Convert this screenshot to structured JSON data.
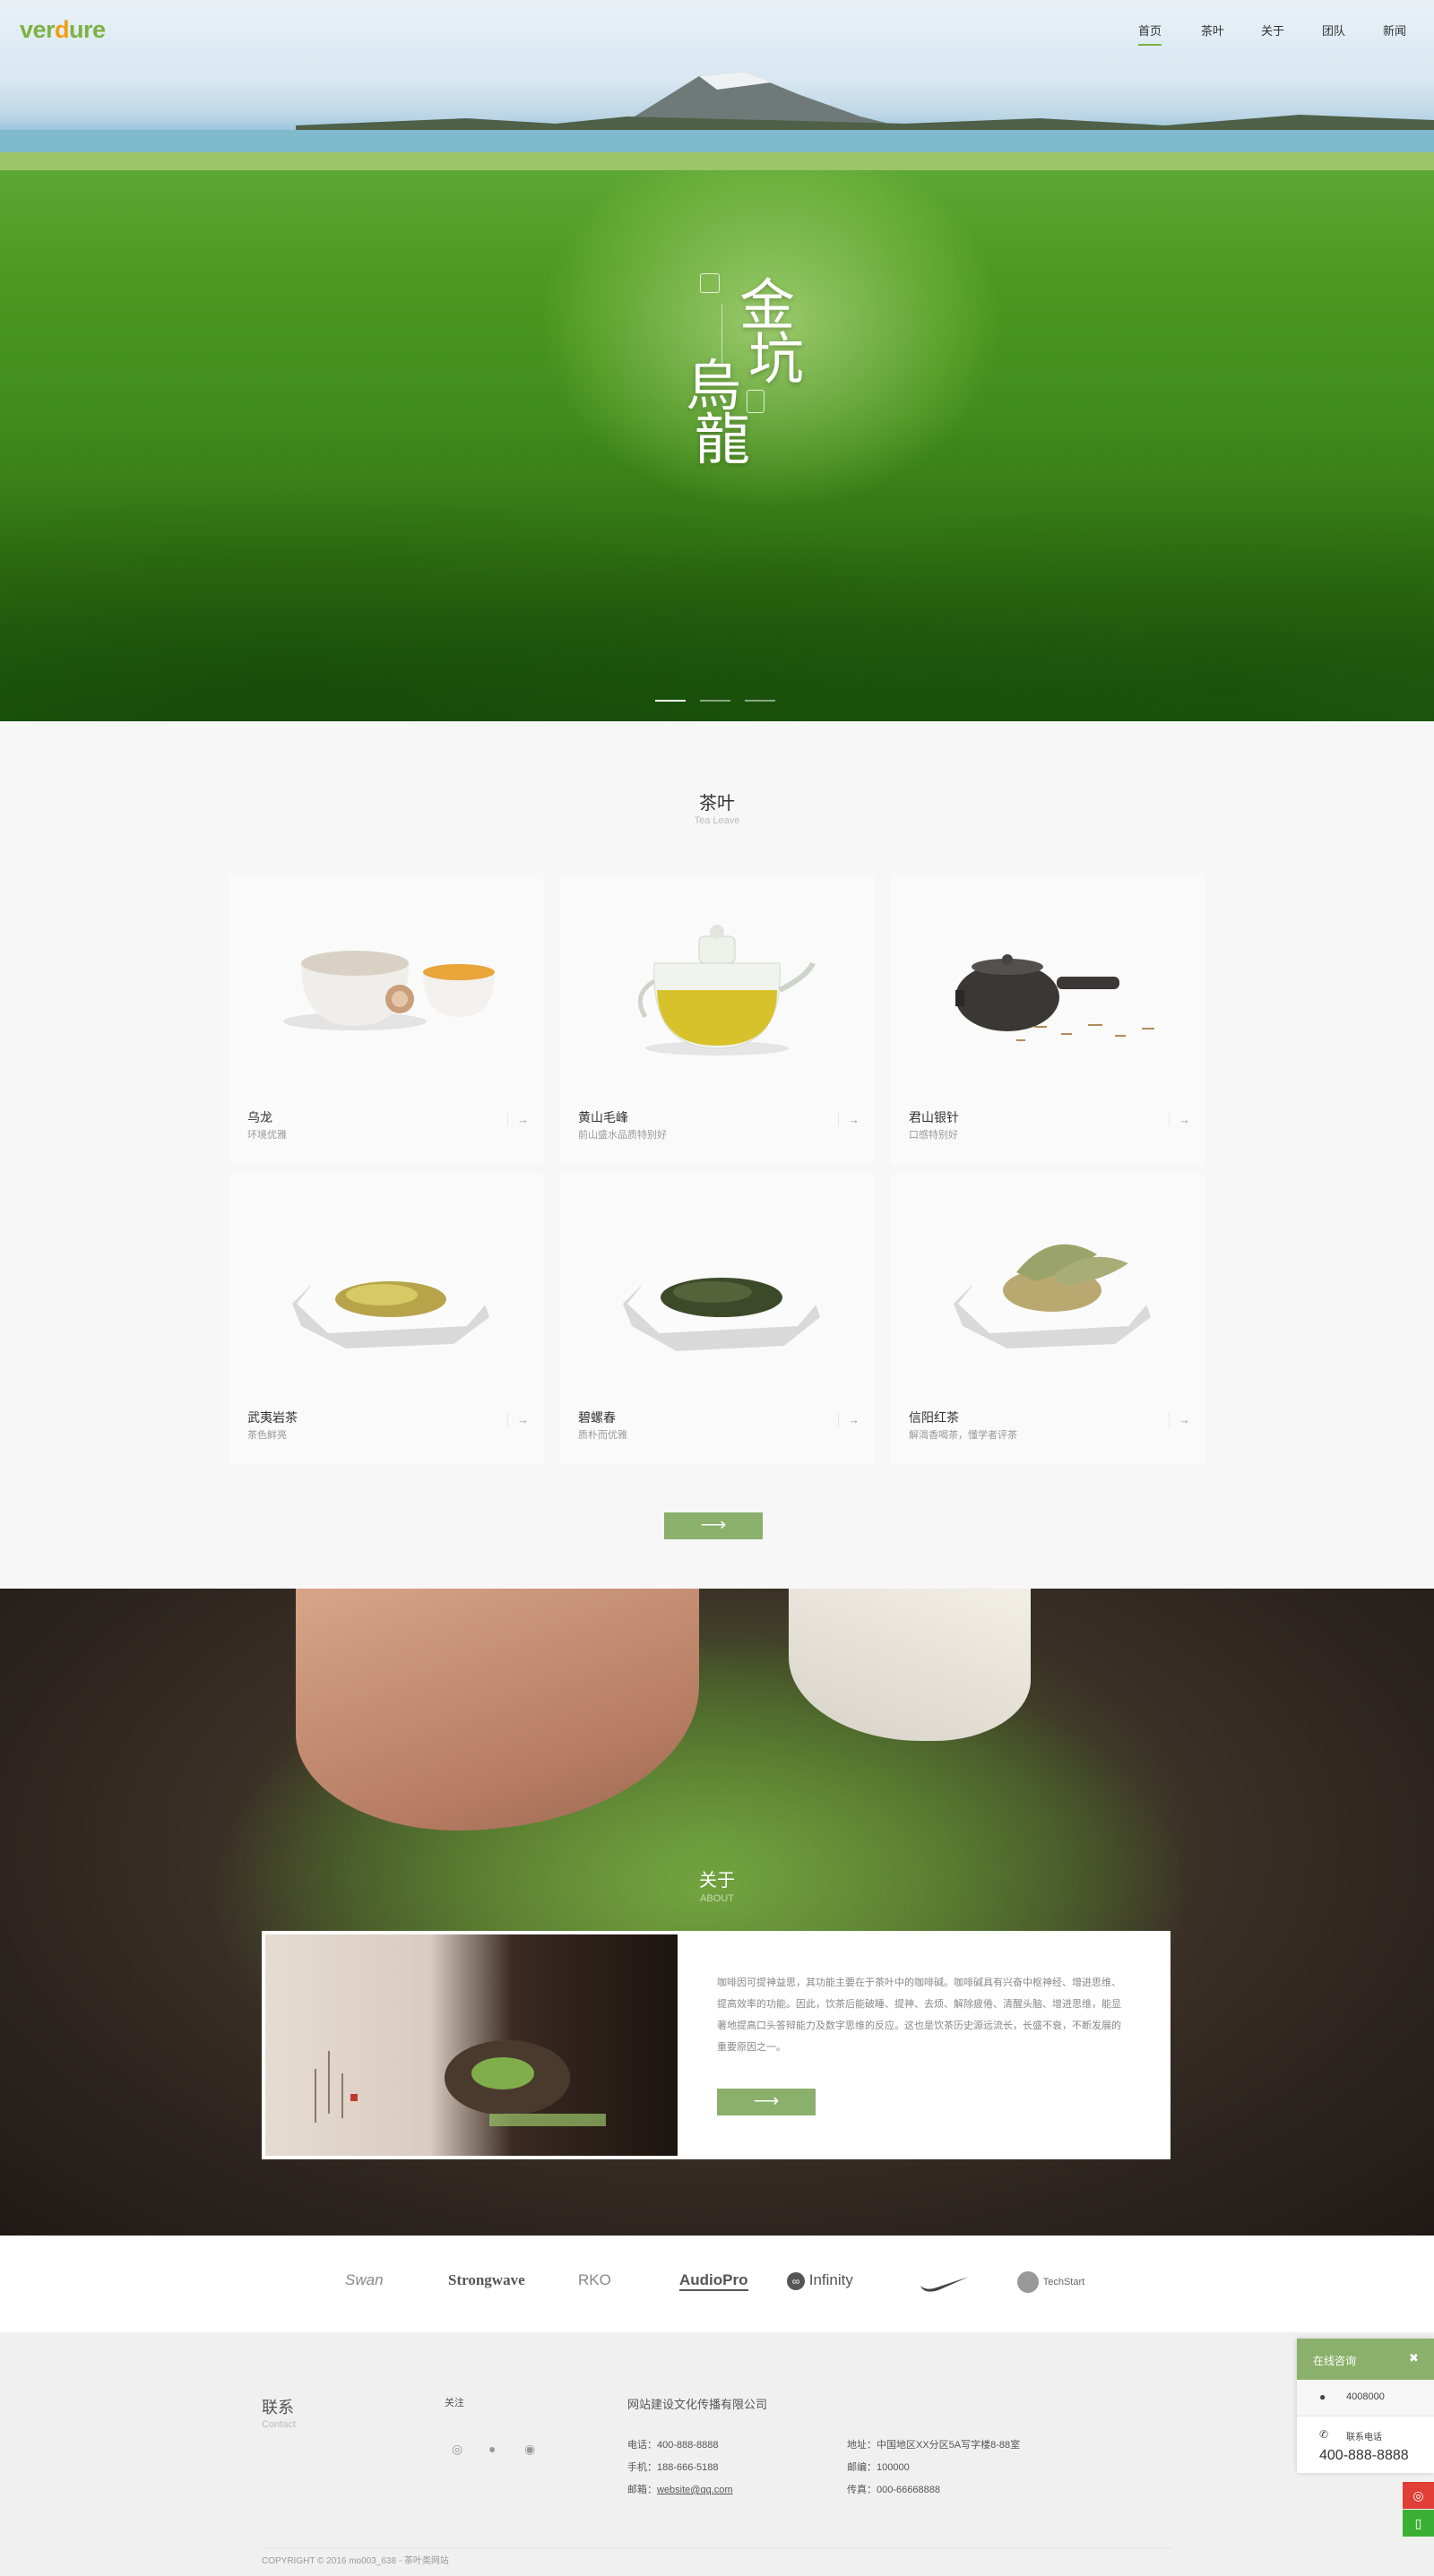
{
  "brand": {
    "logo_a": "ver",
    "logo_b": "d",
    "logo_c": "ure"
  },
  "nav": [
    {
      "label": "首页"
    },
    {
      "label": "茶叶"
    },
    {
      "label": "关于"
    },
    {
      "label": "团队"
    },
    {
      "label": "新闻"
    }
  ],
  "hero": {
    "calligraphy": [
      "金",
      "坑",
      "烏",
      "龍"
    ]
  },
  "tea": {
    "title": "茶叶",
    "subtitle": "Tea Leave",
    "items": [
      {
        "name": "乌龙",
        "desc": "环境优雅"
      },
      {
        "name": "黄山毛峰",
        "desc": "前山盛水品质特别好"
      },
      {
        "name": "君山银针",
        "desc": "口感特别好"
      },
      {
        "name": "武夷岩茶",
        "desc": "茶色鲜亮"
      },
      {
        "name": "碧螺春",
        "desc": "质朴而优雅"
      },
      {
        "name": "信阳红茶",
        "desc": "解渴香喝茶，懂学者评茶"
      }
    ],
    "arrow": "→",
    "more": "⟶"
  },
  "about": {
    "title": "关于",
    "subtitle": "ABOUT",
    "text": "咖啡因可提神益思，其功能主要在于茶叶中的咖啡碱。咖啡碱具有兴奋中枢神经、增进思维、提高效率的功能。因此，饮茶后能破睡、提神、去烦、解除疲倦、清醒头脑、增进思维，能显著地提高口头答辩能力及数字思维的反应。这也是饮茶历史源远流长，长盛不衰，不断发展的重要原因之一。",
    "btn": "⟶"
  },
  "partners": [
    "Swan",
    "Strongwave",
    "RKO",
    "AudioPro",
    "Infinity",
    "",
    "TechStart"
  ],
  "footer": {
    "contact": "联系",
    "contact_en": "Contact",
    "follow": "关注",
    "company": "网站建设文化传播有限公司",
    "phone": "电话：400-888-8888",
    "mobile": "手机：188-666-5188",
    "email_label": "邮箱：",
    "email": "website@qq.com",
    "address": "地址：中国地区XX分区5A写字楼8-88室",
    "postcode": "邮编：100000",
    "fax": "传真：000-66668888",
    "copyright": "COPYRIGHT © 2016 mo003_638 - 茶叶类网站"
  },
  "chat": {
    "title": "在线咨询",
    "close": "✖",
    "qq": "4008000",
    "hotline_label": "联系电话",
    "hotline": "400-888-8888"
  },
  "colors": {
    "accent": "#8bb06b",
    "logo_green": "#7cb342",
    "logo_orange": "#f39c12",
    "weibo": "#e03e36",
    "mobile": "#3cb034"
  }
}
